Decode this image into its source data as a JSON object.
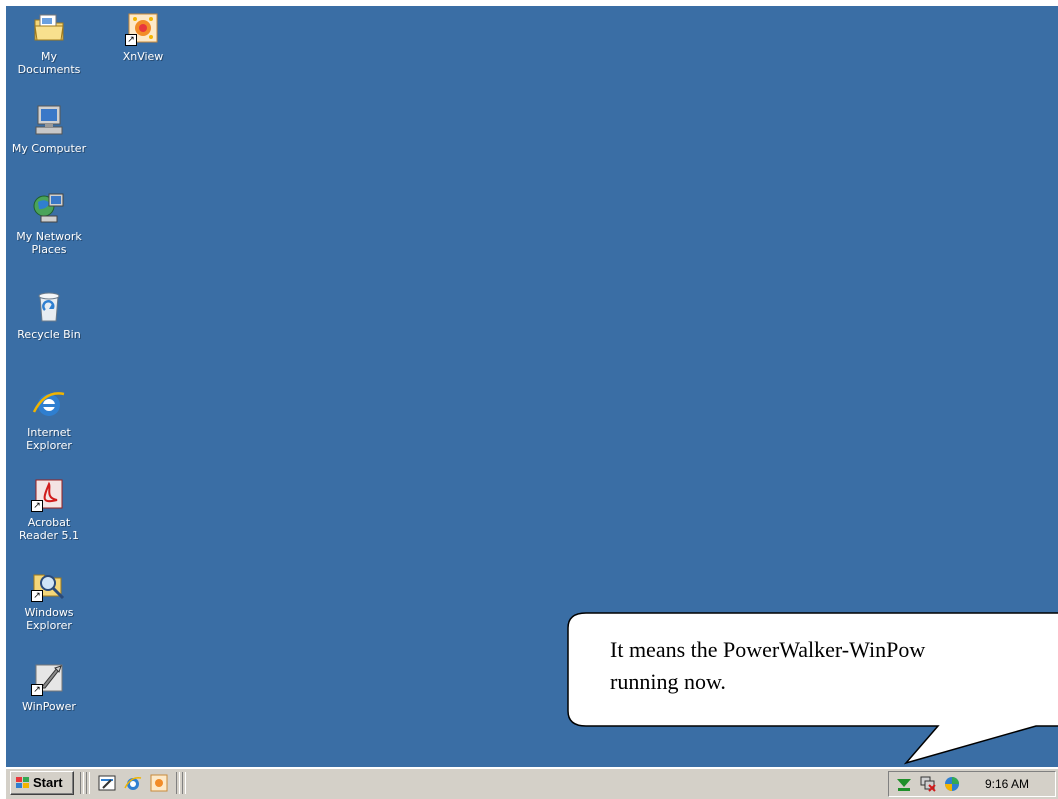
{
  "desktop": {
    "background_color": "#3a6ea5",
    "icons": [
      {
        "label": "My\nDocuments",
        "icon": "folder-documents-icon"
      },
      {
        "label": "XnView",
        "icon": "xnview-icon",
        "shortcut": true
      },
      {
        "label": "My Computer",
        "icon": "computer-icon"
      },
      {
        "label": "My Network\nPlaces",
        "icon": "network-places-icon"
      },
      {
        "label": "Recycle Bin",
        "icon": "recycle-bin-icon"
      },
      {
        "label": "Internet\nExplorer",
        "icon": "internet-explorer-icon"
      },
      {
        "label": "Acrobat\nReader 5.1",
        "icon": "acrobat-reader-icon",
        "shortcut": true
      },
      {
        "label": "Windows\nExplorer",
        "icon": "windows-explorer-icon",
        "shortcut": true
      },
      {
        "label": "WinPower",
        "icon": "winpower-icon",
        "shortcut": true
      }
    ]
  },
  "callout": {
    "text": "It means the PowerWalker-WinPow\nrunning now."
  },
  "taskbar": {
    "start_label": "Start",
    "quick_launch": [
      "show-desktop-icon",
      "internet-explorer-icon",
      "xnview-icon"
    ],
    "tray": {
      "icons": [
        "winpower-tray-icon",
        "network-disconnected-icon",
        "volume-icon"
      ],
      "time": "9:16 AM"
    },
    "background_color": "#d4d0c8"
  }
}
